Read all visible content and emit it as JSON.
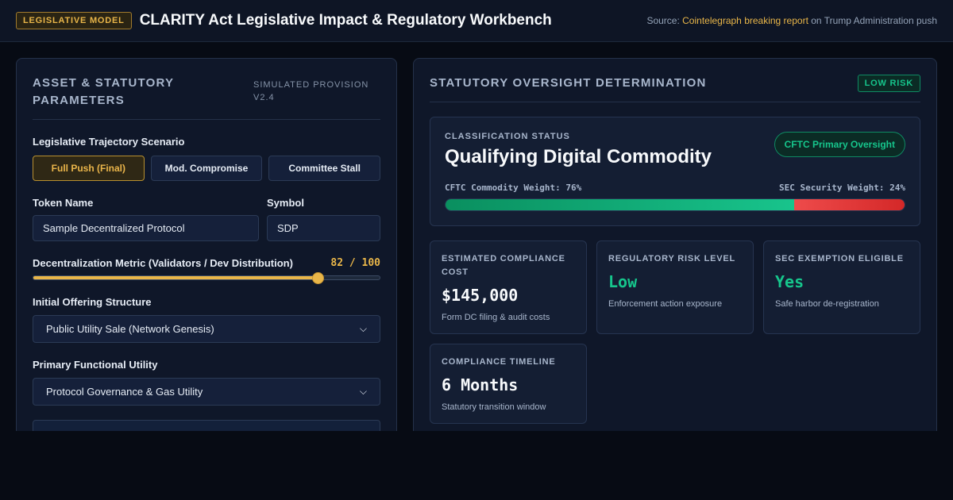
{
  "header": {
    "badge": "LEGISLATIVE MODEL",
    "title": "CLARITY Act Legislative Impact & Regulatory Workbench",
    "source_prefix": "Source: ",
    "source_link": "Cointelegraph breaking report",
    "source_suffix": " on Trump Administration push"
  },
  "left_panel": {
    "title": "Asset & Statutory Parameters",
    "provision": "Simulated Provision v2.4",
    "scenario_label": "Legislative Trajectory Scenario",
    "scenarios": [
      {
        "label": "Full Push (Final)",
        "active": true
      },
      {
        "label": "Mod. Compromise",
        "active": false
      },
      {
        "label": "Committee Stall",
        "active": false
      }
    ],
    "token_name_label": "Token Name",
    "token_name_value": "Sample Decentralized Protocol",
    "symbol_label": "Symbol",
    "symbol_value": "SDP",
    "metric_label": "Decentralization Metric (Validators / Dev Distribution)",
    "metric_value": 82,
    "metric_max": 100,
    "metric_display": "82 / 100",
    "offering_label": "Initial Offering Structure",
    "offering_value": "Public Utility Sale (Network Genesis)",
    "utility_label": "Primary Functional Utility",
    "utility_value": "Protocol Governance & Gas Utility"
  },
  "right_panel": {
    "title": "Statutory Oversight Determination",
    "risk_badge": "LOW RISK",
    "classification": {
      "eyebrow": "Classification Status",
      "title": "Qualifying Digital Commodity",
      "pill": "CFTC Primary Oversight",
      "cftc_label": "CFTC Commodity Weight: 76%",
      "sec_label": "SEC Security Weight: 24%",
      "cftc_weight": 76,
      "sec_weight": 24
    },
    "stats": [
      {
        "label": "Estimated Compliance Cost",
        "value": "$145,000",
        "sub": "Form DC filing & audit costs",
        "green": false
      },
      {
        "label": "Regulatory Risk Level",
        "value": "Low",
        "sub": "Enforcement action exposure",
        "green": true
      },
      {
        "label": "SEC Exemption Eligible",
        "value": "Yes",
        "sub": "Safe harbor de-registration",
        "green": true
      },
      {
        "label": "Compliance Timeline",
        "value": "6 Months",
        "sub": "Statutory transition window",
        "green": false
      }
    ]
  },
  "colors": {
    "accent_gold": "#e9b649",
    "status_green": "#16c68c",
    "sec_red": "#e23b3b",
    "background": "#070b14"
  }
}
